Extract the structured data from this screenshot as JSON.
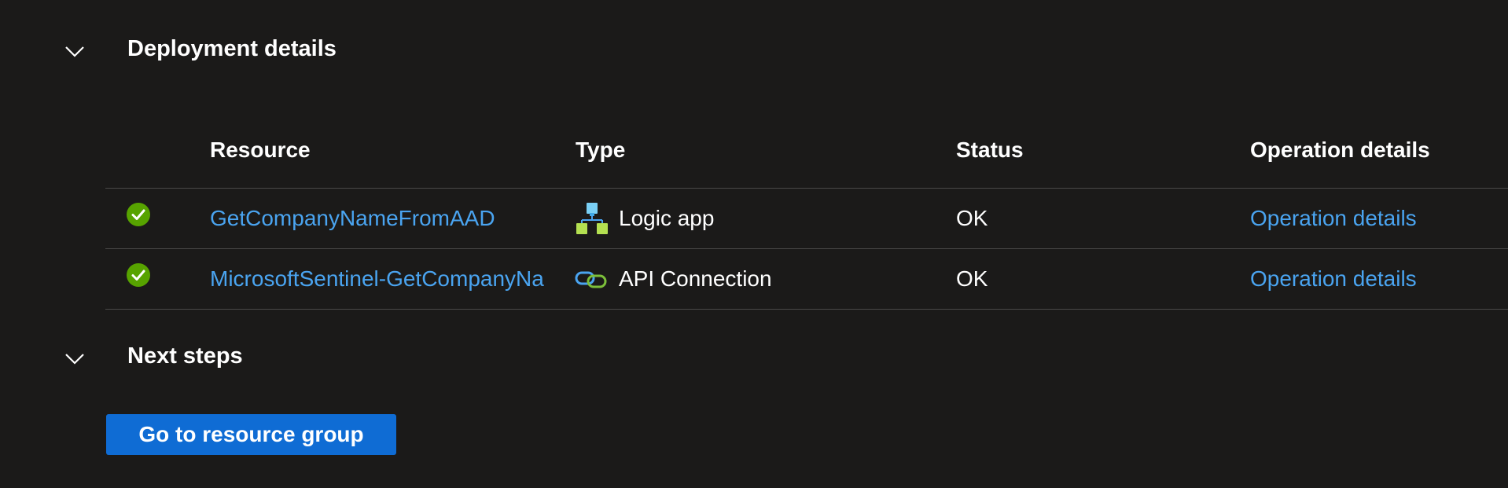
{
  "deployment_details": {
    "title": "Deployment details",
    "columns": {
      "resource": "Resource",
      "type": "Type",
      "status": "Status",
      "operation_details": "Operation details"
    },
    "rows": [
      {
        "resource": "GetCompanyNameFromAAD",
        "type": "Logic app",
        "type_icon": "logic-app-icon",
        "status": "OK",
        "status_icon": "success-check-icon",
        "operation_details": "Operation details"
      },
      {
        "resource": "MicrosoftSentinel-GetCompanyNa",
        "type": "API Connection",
        "type_icon": "api-connection-icon",
        "status": "OK",
        "status_icon": "success-check-icon",
        "operation_details": "Operation details"
      }
    ]
  },
  "next_steps": {
    "title": "Next steps",
    "button_label": "Go to resource group"
  },
  "colors": {
    "background": "#1b1a19",
    "link": "#4aa4f0",
    "primary_button": "#0f6cd4",
    "success": "#57a300",
    "divider": "#4a4948"
  }
}
